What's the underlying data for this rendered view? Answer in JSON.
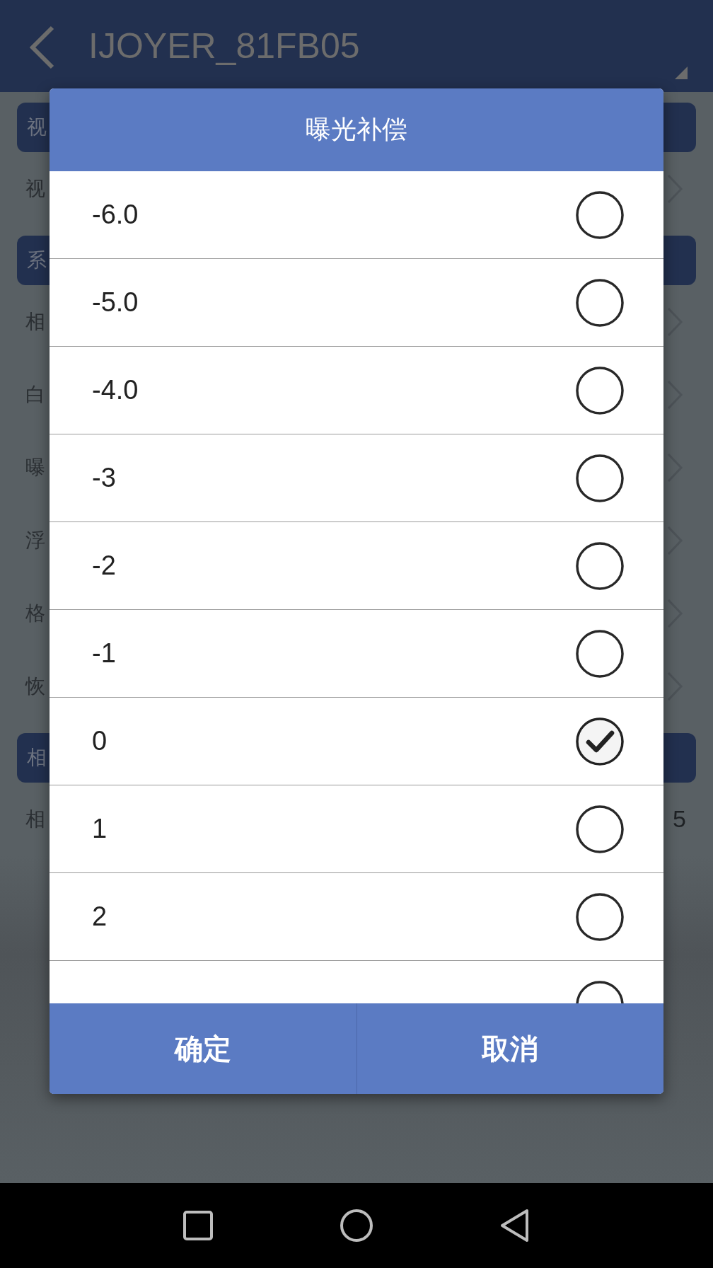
{
  "app_bar": {
    "title": "IJOYER_81FB05"
  },
  "background": {
    "items": [
      {
        "kind": "header",
        "label": "视"
      },
      {
        "kind": "nav-row",
        "label": "视"
      },
      {
        "kind": "header",
        "label": "系"
      },
      {
        "kind": "nav-row",
        "label": "相"
      },
      {
        "kind": "nav-row",
        "label": "白"
      },
      {
        "kind": "nav-row",
        "label": "曝"
      },
      {
        "kind": "nav-row",
        "label": "浮"
      },
      {
        "kind": "nav-row",
        "label": "格"
      },
      {
        "kind": "nav-row",
        "label": "恢"
      },
      {
        "kind": "header",
        "label": "相"
      },
      {
        "kind": "value-row",
        "label": "相",
        "value": "5"
      }
    ]
  },
  "dialog": {
    "title": "曝光补偿",
    "options": [
      {
        "label": "-6.0",
        "selected": false
      },
      {
        "label": "-5.0",
        "selected": false
      },
      {
        "label": "-4.0",
        "selected": false
      },
      {
        "label": "-3",
        "selected": false
      },
      {
        "label": "-2",
        "selected": false
      },
      {
        "label": "-1",
        "selected": false
      },
      {
        "label": "0",
        "selected": true
      },
      {
        "label": "1",
        "selected": false
      },
      {
        "label": "2",
        "selected": false
      },
      {
        "selected": false
      }
    ],
    "buttons": [
      "确定",
      "取消"
    ]
  }
}
